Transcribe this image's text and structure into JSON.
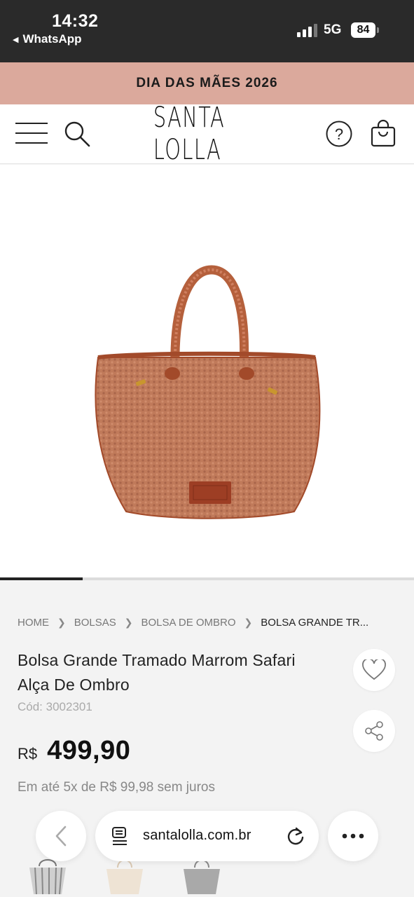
{
  "status_bar": {
    "time": "14:32",
    "back_app": "WhatsApp",
    "network": "5G",
    "battery": "84"
  },
  "promo_banner": {
    "text": "DIA DAS MÃES 2026"
  },
  "header": {
    "logo_text": "SANTA LOLLA",
    "icons": [
      "menu-icon",
      "search-icon",
      "help-icon",
      "shopping-bag-icon"
    ]
  },
  "gallery": {
    "image_description_icon": "woven-tote-bag",
    "progress_fraction": 0.2
  },
  "breadcrumb": {
    "items": [
      "HOME",
      "BOLSAS",
      "BOLSA DE OMBRO",
      "BOLSA GRANDE TR..."
    ]
  },
  "product": {
    "title_line1": "Bolsa Grande Tramado Marrom Safari",
    "title_line2": "Alça De Ombro",
    "code": "Cód: 3002301",
    "currency": "R$",
    "price": "499,90",
    "installments": "Em até 5x de R$ 99,98 sem juros"
  },
  "browser": {
    "url": "santalolla.com.br",
    "icons": [
      "back-arrow-icon",
      "page-icon",
      "reload-icon",
      "more-icon"
    ]
  },
  "colors": {
    "promo_bg": "#dba99c",
    "status_bg": "#2a2a2a",
    "bag_main": "#c07a5a",
    "bag_trim": "#a24a2a"
  }
}
